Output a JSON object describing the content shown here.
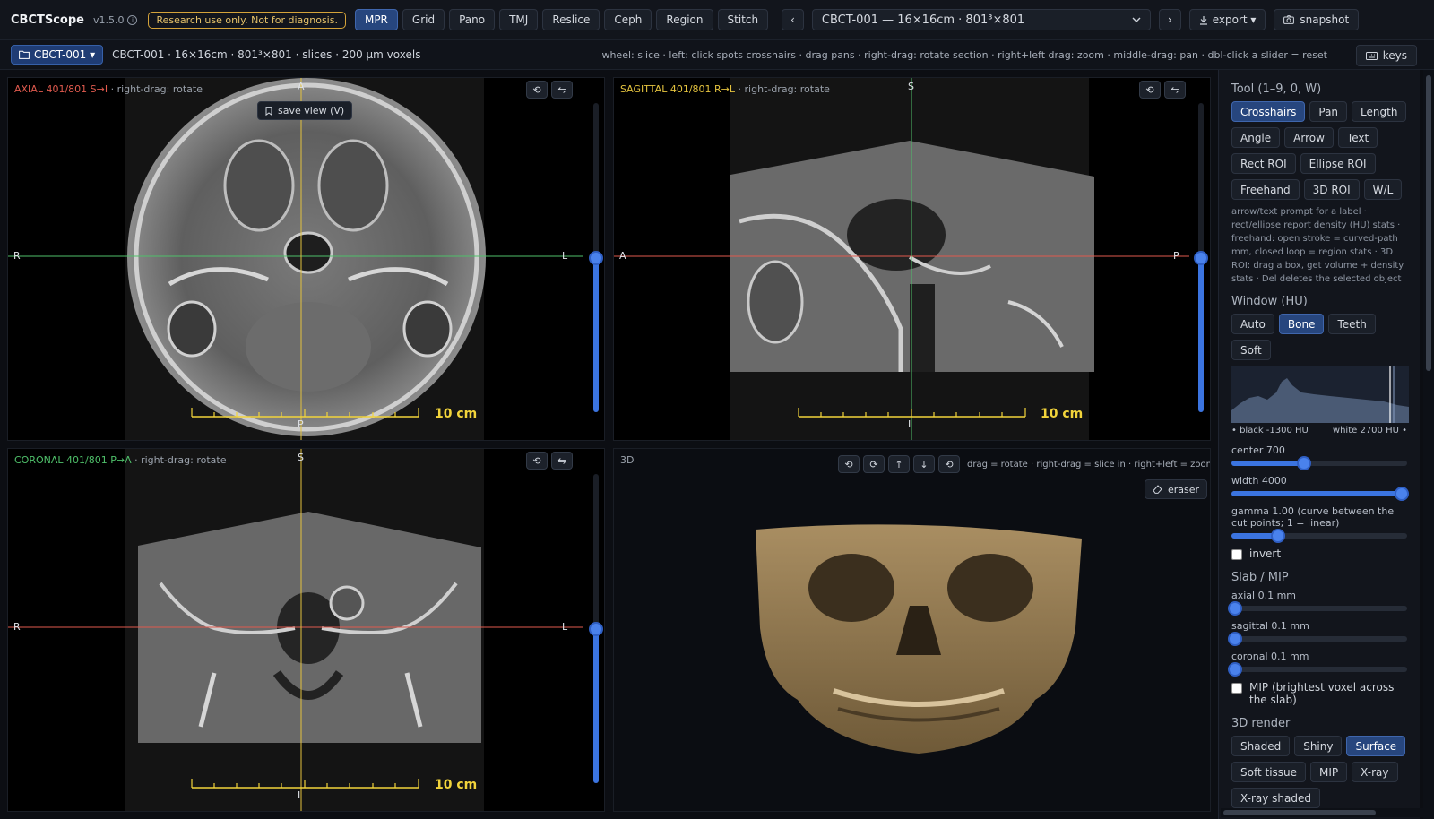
{
  "app": {
    "name": "CBCTScope",
    "version": "v1.5.0",
    "warning": "Research use only. Not for diagnosis."
  },
  "modes": [
    {
      "label": "MPR",
      "active": true
    },
    {
      "label": "Grid",
      "active": false
    },
    {
      "label": "Pano",
      "active": false
    },
    {
      "label": "TMJ",
      "active": false
    },
    {
      "label": "Reslice",
      "active": false
    },
    {
      "label": "Ceph",
      "active": false
    },
    {
      "label": "Region",
      "active": false
    },
    {
      "label": "Stitch",
      "active": false
    }
  ],
  "nav": {
    "prev": "‹",
    "next": "›",
    "dataset": "CBCT-001 — 16×16cm · 801³×801",
    "export": "export",
    "snapshot": "snapshot"
  },
  "subbar": {
    "case_button": "CBCT-001",
    "case_info": "CBCT-001 · 16×16cm · 801³×801 · slices · 200 µm voxels",
    "hint": "wheel: slice · left: click spots crosshairs · drag pans · right-drag: rotate section · right+left drag: zoom · middle-drag: pan · dbl-click a slider = reset",
    "keys": "keys"
  },
  "viewports": {
    "axial": {
      "label": "AXIAL 401/801 S→I",
      "hint": "· right-drag: rotate",
      "save": "save view (V)",
      "top": "A",
      "bottom": "P",
      "left": "R",
      "right": "L",
      "scale": "10 cm",
      "slice_fraction": 0.5
    },
    "sagittal": {
      "label": "SAGITTAL 401/801 R→L",
      "hint": "· right-drag: rotate",
      "top": "S",
      "bottom": "I",
      "left": "A",
      "right": "P",
      "scale": "10 cm",
      "slice_fraction": 0.5
    },
    "coronal": {
      "label": "CORONAL 401/801 P→A",
      "hint": "· right-drag: rotate",
      "top": "S",
      "bottom": "I",
      "left": "R",
      "right": "L",
      "scale": "10 cm",
      "slice_fraction": 0.5
    },
    "three_d": {
      "label": "3D",
      "hint": "drag = rotate · right-drag = slice in · right+left = zoom",
      "eraser": "eraser"
    }
  },
  "panel": {
    "tool_title": "Tool (1–9, 0, W)",
    "tools": [
      {
        "label": "Crosshairs",
        "active": true
      },
      {
        "label": "Pan",
        "active": false
      },
      {
        "label": "Length",
        "active": false
      },
      {
        "label": "Angle",
        "active": false
      },
      {
        "label": "Arrow",
        "active": false
      },
      {
        "label": "Text",
        "active": false
      },
      {
        "label": "Rect ROI",
        "active": false
      },
      {
        "label": "Ellipse ROI",
        "active": false
      },
      {
        "label": "Freehand",
        "active": false
      },
      {
        "label": "3D ROI",
        "active": false
      },
      {
        "label": "W/L",
        "active": false
      }
    ],
    "tool_help": "arrow/text prompt for a label · rect/ellipse report density (HU) stats · freehand: open stroke = curved-path mm, closed loop = region stats · 3D ROI: drag a box, get volume + density stats · Del deletes the selected object",
    "window_title": "Window (HU)",
    "window_presets": [
      {
        "label": "Auto",
        "active": false
      },
      {
        "label": "Bone",
        "active": true
      },
      {
        "label": "Teeth",
        "active": false
      },
      {
        "label": "Soft",
        "active": false
      }
    ],
    "histogram": {
      "black": "• black -1300 HU",
      "white": "white 2700 HU •"
    },
    "center": {
      "label": "center 700",
      "fraction": 0.42
    },
    "width": {
      "label": "width 4000",
      "fraction": 0.98
    },
    "gamma": {
      "label": "gamma 1.00 (curve between the cut points; 1 = linear)",
      "fraction": 0.27
    },
    "invert": "invert",
    "slab_title": "Slab / MIP",
    "slab": [
      {
        "label": "axial 0.1 mm",
        "fraction": 0.02
      },
      {
        "label": "sagittal 0.1 mm",
        "fraction": 0.02
      },
      {
        "label": "coronal 0.1 mm",
        "fraction": 0.02
      }
    ],
    "mip": "MIP (brightest voxel across the slab)",
    "render_title": "3D render",
    "render_modes": [
      {
        "label": "Shaded",
        "active": false
      },
      {
        "label": "Shiny",
        "active": false
      },
      {
        "label": "Surface",
        "active": true
      },
      {
        "label": "Soft tissue",
        "active": false
      },
      {
        "label": "MIP",
        "active": false
      },
      {
        "label": "X-ray",
        "active": false
      },
      {
        "label": "X-ray shaded",
        "active": false
      }
    ]
  },
  "colors": {
    "accent": "#3b74e0",
    "axial": "#e05a4e",
    "sagittal": "#e3c23e",
    "coronal": "#4fc06a",
    "scale": "#f2d43b"
  }
}
